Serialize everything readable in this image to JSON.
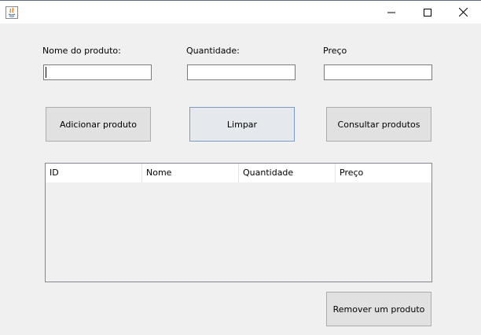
{
  "window": {
    "app_icon": "java-icon",
    "controls": [
      "minimize-icon",
      "maximize-icon",
      "close-icon"
    ]
  },
  "form": {
    "name_label": "Nome do produto:",
    "quantity_label": "Quantidade:",
    "price_label": "Preço",
    "name_value": "",
    "quantity_value": "",
    "price_value": ""
  },
  "buttons": {
    "add": "Adicionar produto",
    "clear": "Limpar",
    "query": "Consultar produtos",
    "remove": "Remover um produto"
  },
  "table": {
    "columns": [
      "ID",
      "Nome",
      "Quantidade",
      "Preço"
    ],
    "rows": []
  }
}
